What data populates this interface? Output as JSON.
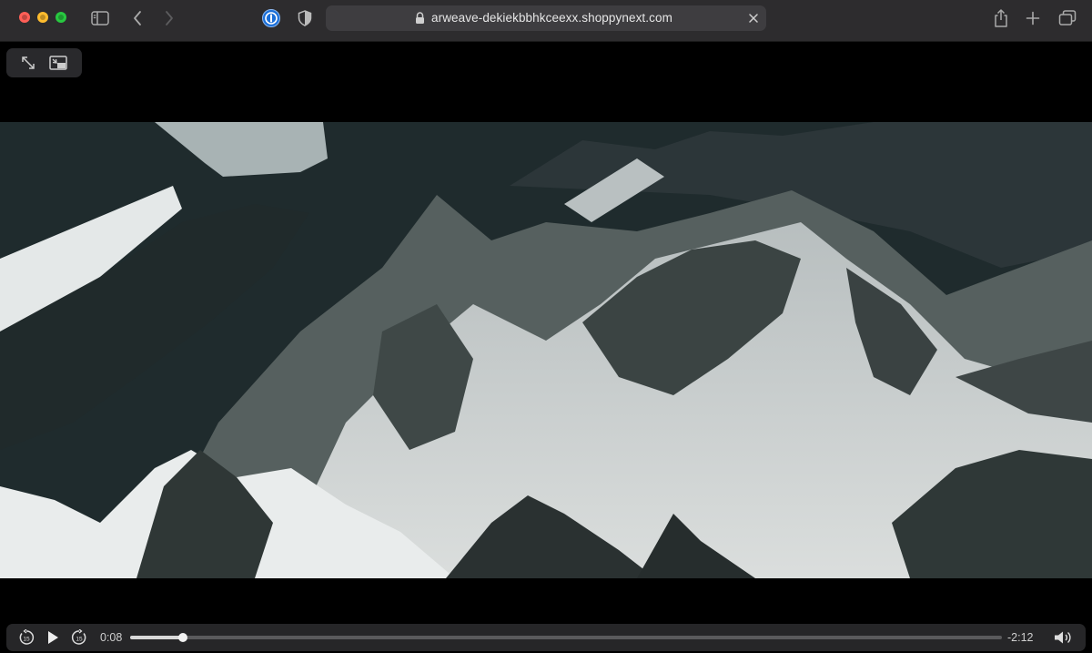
{
  "browser": {
    "url": "arweave-dekiekbbhkceexx.shoppynext.com",
    "icons": {
      "sidebar": "sidebar-icon",
      "back": "chevron-left-icon",
      "forward": "chevron-right-icon",
      "password": "password-manager-icon",
      "shield": "shield-icon",
      "lock": "lock-icon",
      "clear": "close-icon",
      "share": "share-icon",
      "new_tab": "plus-icon",
      "tabs": "tab-overview-icon"
    }
  },
  "video": {
    "controls_top": {
      "fullscreen": "expand-icon",
      "pip": "picture-in-picture-icon"
    },
    "playback": {
      "current_time": "0:08",
      "remaining_time": "-2:12",
      "progress": 0.0606,
      "skip_back": "15",
      "skip_forward": "15"
    }
  },
  "colors": {
    "toolbar_bg": "#2d2c2e",
    "addr_bg": "#3e3d40",
    "close": "#ff5f57",
    "minimize": "#febc2e",
    "zoom": "#28c840"
  }
}
